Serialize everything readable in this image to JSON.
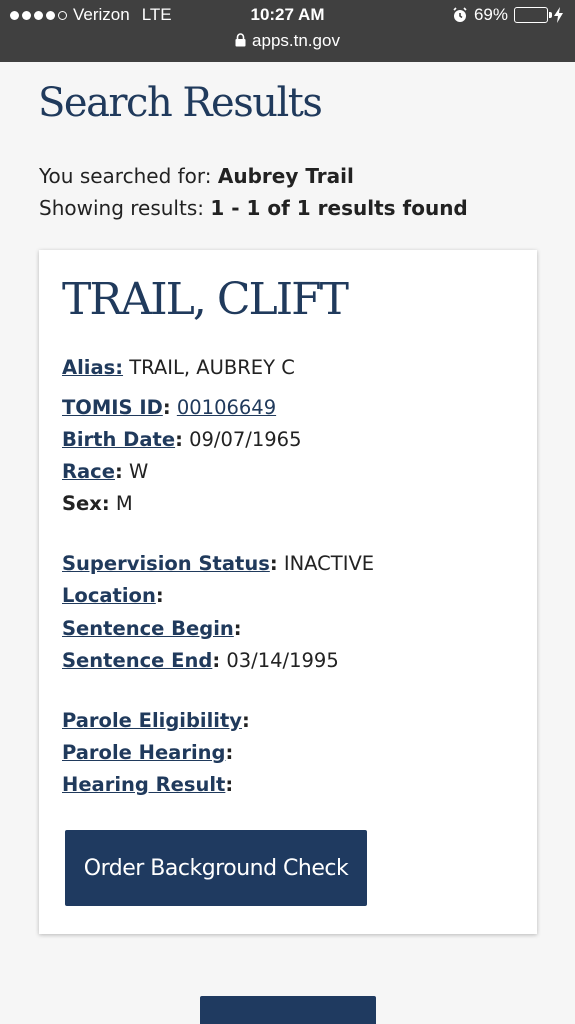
{
  "status_bar": {
    "carrier": "Verizon",
    "network": "LTE",
    "time": "10:27 AM",
    "battery": "69%",
    "battery_level": 0.69,
    "url": "apps.tn.gov"
  },
  "page": {
    "title": "Search Results",
    "searched_label": "You searched for: ",
    "searched_value": "Aubrey Trail",
    "showing_label": "Showing results: ",
    "showing_value": "1 - 1 of 1 results found"
  },
  "record": {
    "name": "TRAIL, CLIFT",
    "alias_label": "Alias:",
    "alias_value": "TRAIL, AUBREY C",
    "tomis_label": "TOMIS ID",
    "tomis_value": "00106649",
    "birth_label": "Birth Date",
    "birth_value": "09/07/1965",
    "race_label": "Race",
    "race_value": "W",
    "sex_label": "Sex:",
    "sex_value": "M",
    "supervision_label": "Supervision Status",
    "supervision_value": "INACTIVE",
    "location_label": "Location",
    "sentence_begin_label": "Sentence Begin",
    "sentence_end_label": "Sentence End",
    "sentence_end_value": "03/14/1995",
    "parole_elig_label": "Parole Eligibility",
    "parole_hearing_label": "Parole Hearing",
    "hearing_result_label": "Hearing Result",
    "order_button": "Order Background Check"
  },
  "colors": {
    "primary": "#1f3a60",
    "status_bar": "#404040",
    "battery": "#4cd964"
  }
}
